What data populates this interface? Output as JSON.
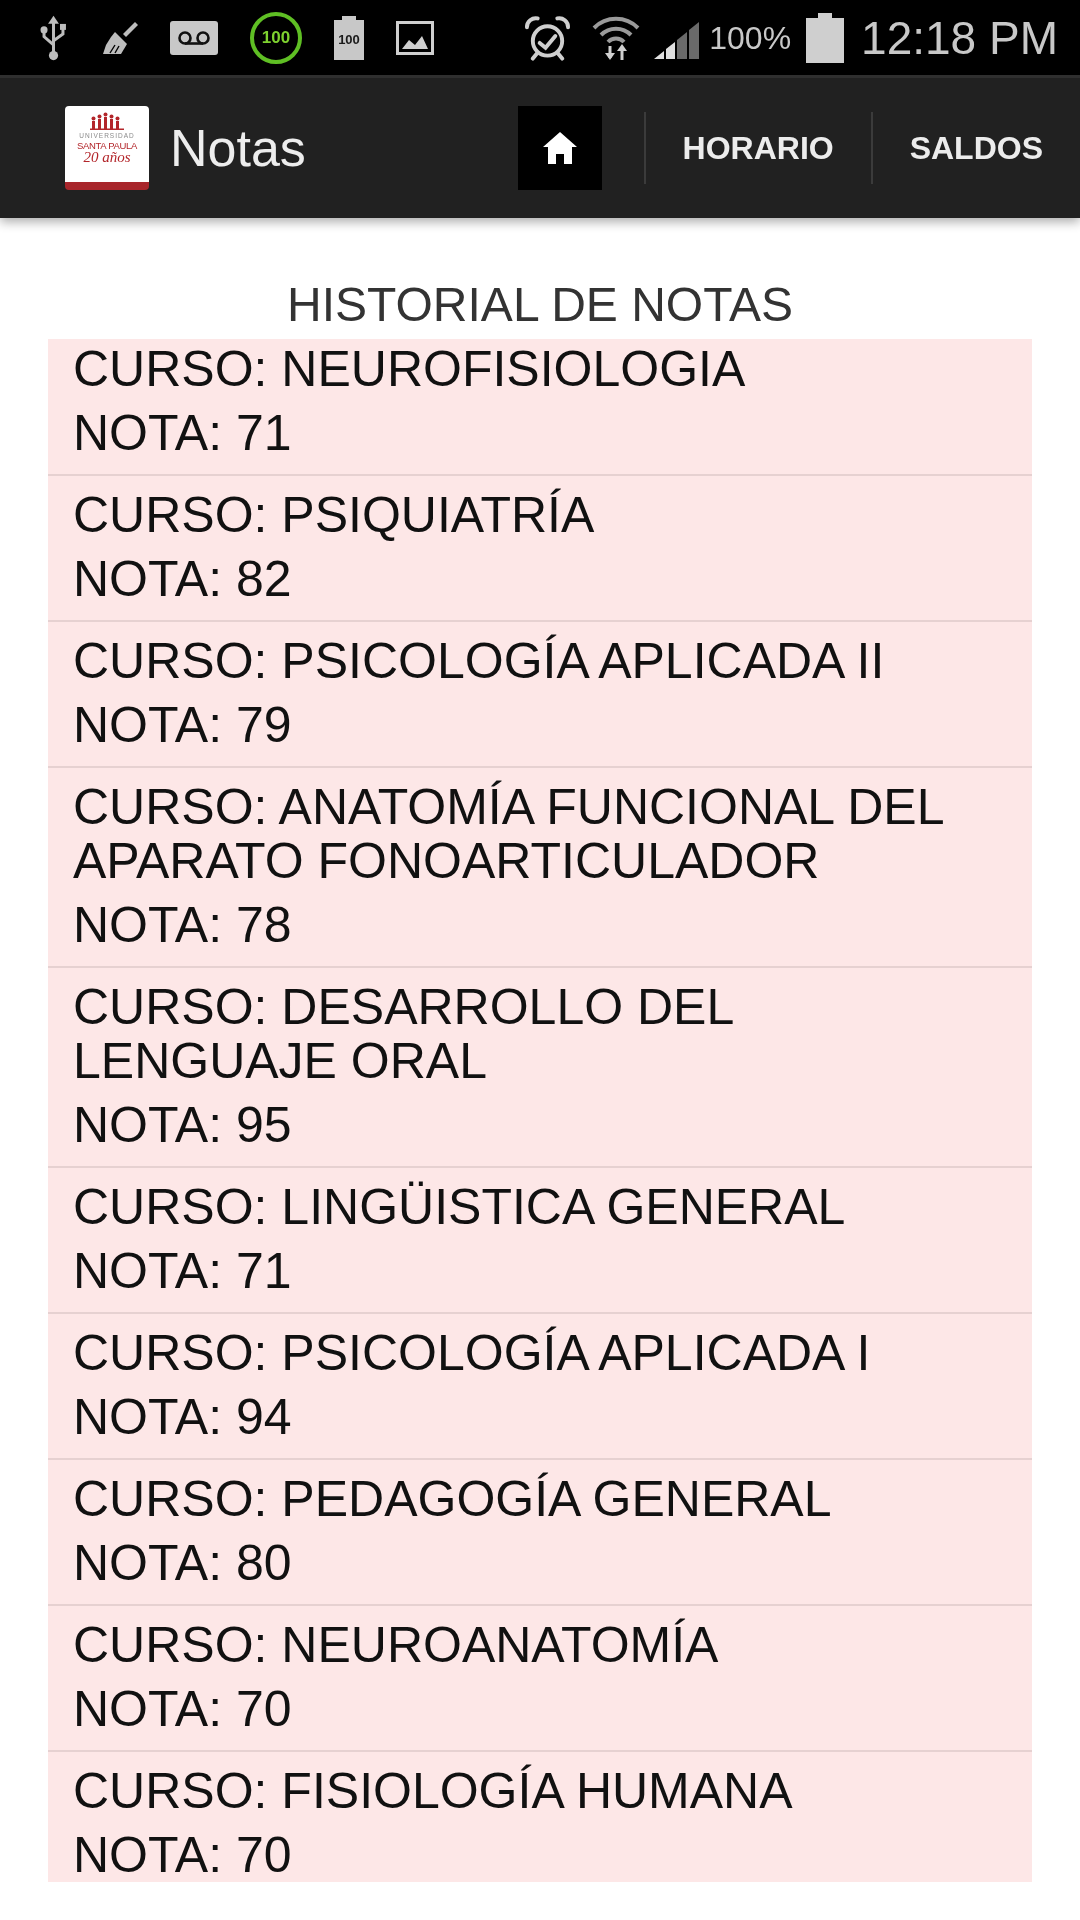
{
  "status_bar": {
    "circle_badge": "100",
    "battery_badge": "100",
    "battery_percent": "100%",
    "time": "12:18 PM"
  },
  "app_bar": {
    "logo_lines": [
      "UNIVERSIDAD",
      "SANTA PAULA",
      "20 años"
    ],
    "title": "Notas",
    "nav": [
      {
        "kind": "icon",
        "selected": true
      },
      {
        "kind": "text",
        "label": "HORARIO",
        "selected": false
      },
      {
        "kind": "text",
        "label": "SALDOS",
        "selected": false
      }
    ]
  },
  "heading": "HISTORIAL DE NOTAS",
  "grades": [
    {
      "course": "CURSO: NEUROFISIOLOGIA",
      "grade": "NOTA: 71"
    },
    {
      "course": "CURSO: PSIQUIATRÍA",
      "grade": "NOTA: 82"
    },
    {
      "course": "CURSO: PSICOLOGÍA APLICADA II",
      "grade": "NOTA: 79"
    },
    {
      "course": "CURSO: ANATOMÍA FUNCIONAL DEL APARATO FONOARTICULADOR",
      "grade": "NOTA: 78"
    },
    {
      "course": "CURSO: DESARROLLO DEL LENGUAJE ORAL",
      "grade": "NOTA: 95"
    },
    {
      "course": "CURSO: LINGÜISTICA GENERAL",
      "grade": "NOTA: 71"
    },
    {
      "course": "CURSO: PSICOLOGÍA APLICADA I",
      "grade": "NOTA: 94"
    },
    {
      "course": "CURSO: PEDAGOGÍA GENERAL",
      "grade": "NOTA: 80"
    },
    {
      "course": "CURSO: NEUROANATOMÍA",
      "grade": "NOTA: 70"
    },
    {
      "course": "CURSO: FISIOLOGÍA HUMANA",
      "grade": "NOTA: 70"
    }
  ]
}
